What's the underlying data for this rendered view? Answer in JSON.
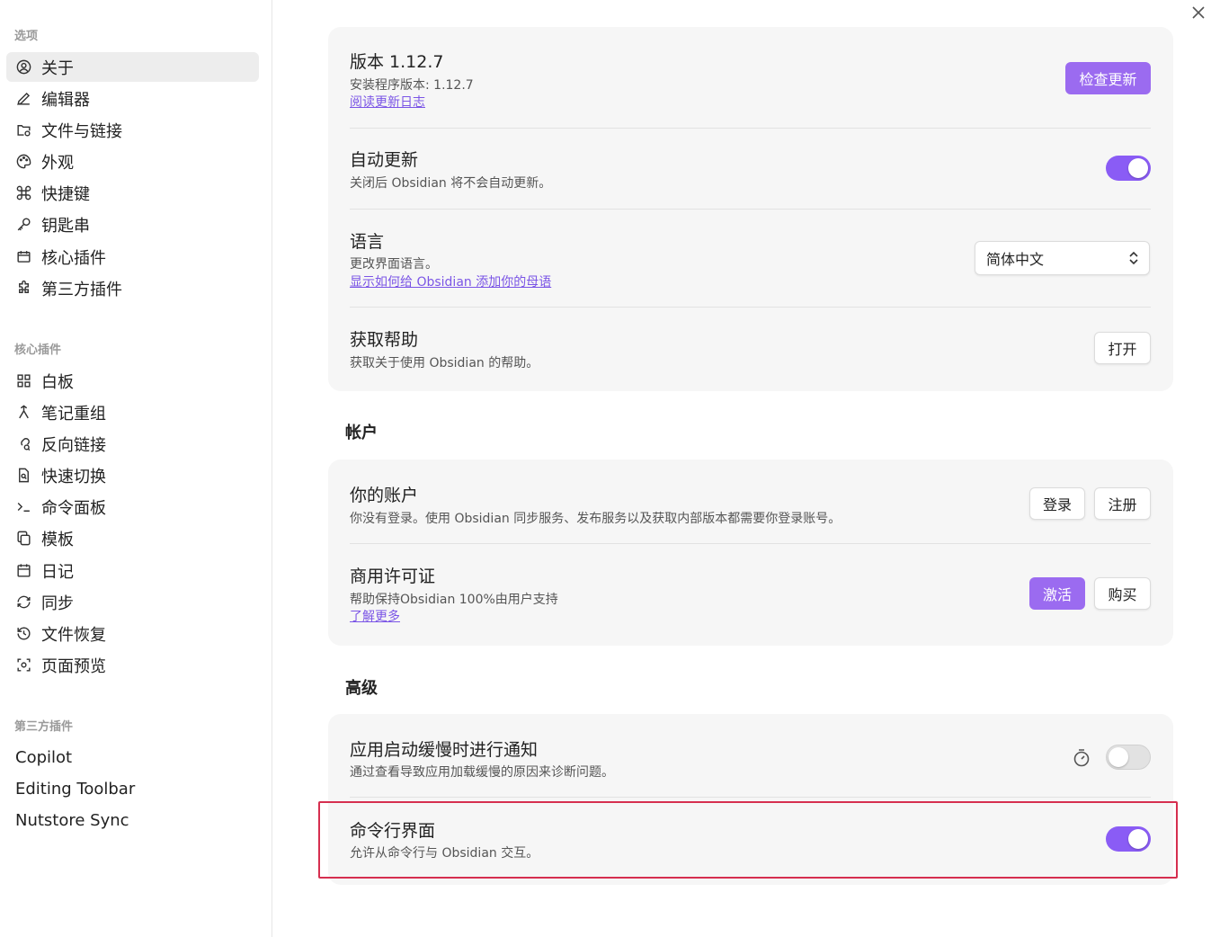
{
  "sidebar": {
    "options_heading": "选项",
    "options": [
      {
        "label": "关于",
        "icon": "user-circle-icon"
      },
      {
        "label": "编辑器",
        "icon": "pencil-icon"
      },
      {
        "label": "文件与链接",
        "icon": "folder-cog-icon"
      },
      {
        "label": "外观",
        "icon": "palette-icon"
      },
      {
        "label": "快捷键",
        "icon": "command-icon"
      },
      {
        "label": "钥匙串",
        "icon": "key-icon"
      },
      {
        "label": "核心插件",
        "icon": "calendar-box-icon"
      },
      {
        "label": "第三方插件",
        "icon": "puzzle-icon"
      }
    ],
    "core_heading": "核心插件",
    "core": [
      {
        "label": "白板",
        "icon": "layout-grid-icon"
      },
      {
        "label": "笔记重组",
        "icon": "merge-icon"
      },
      {
        "label": "反向链接",
        "icon": "link-search-icon"
      },
      {
        "label": "快速切换",
        "icon": "file-search-icon"
      },
      {
        "label": "命令面板",
        "icon": "terminal-icon"
      },
      {
        "label": "模板",
        "icon": "copy-icon"
      },
      {
        "label": "日记",
        "icon": "calendar-icon"
      },
      {
        "label": "同步",
        "icon": "refresh-icon"
      },
      {
        "label": "文件恢复",
        "icon": "history-icon"
      },
      {
        "label": "页面预览",
        "icon": "scan-eye-icon"
      }
    ],
    "third_heading": "第三方插件",
    "third": [
      {
        "label": "Copilot"
      },
      {
        "label": "Editing Toolbar"
      },
      {
        "label": "Nutstore Sync"
      }
    ]
  },
  "about": {
    "version_title": "版本 1.12.7",
    "installer_version": "安装程序版本: 1.12.7",
    "changelog_link": "阅读更新日志",
    "check_update_button": "检查更新",
    "auto_update_title": "自动更新",
    "auto_update_desc": "关闭后 Obsidian 将不会自动更新。",
    "auto_update_on": true,
    "language_title": "语言",
    "language_desc": "更改界面语言。",
    "language_link": "显示如何给 Obsidian 添加你的母语",
    "language_value": "简体中文",
    "help_title": "获取帮助",
    "help_desc": "获取关于使用 Obsidian 的帮助。",
    "help_button": "打开"
  },
  "account": {
    "heading": "帐户",
    "your_account_title": "你的账户",
    "your_account_desc": "你没有登录。使用 Obsidian 同步服务、发布服务以及获取内部版本都需要你登录账号。",
    "login_button": "登录",
    "signup_button": "注册",
    "license_title": "商用许可证",
    "license_desc": "帮助保持Obsidian 100%由用户支持",
    "license_link": "了解更多",
    "activate_button": "激活",
    "buy_button": "购买"
  },
  "advanced": {
    "heading": "高级",
    "slow_start_title": "应用启动缓慢时进行通知",
    "slow_start_desc": "通过查看导致应用加载缓慢的原因来诊断问题。",
    "slow_start_on": false,
    "cli_title": "命令行界面",
    "cli_desc": "允许从命令行与 Obsidian 交互。",
    "cli_on": true
  },
  "colors": {
    "accent": "#9b6bf0",
    "highlight_border": "#d62f4f",
    "link": "#7b55e6"
  }
}
